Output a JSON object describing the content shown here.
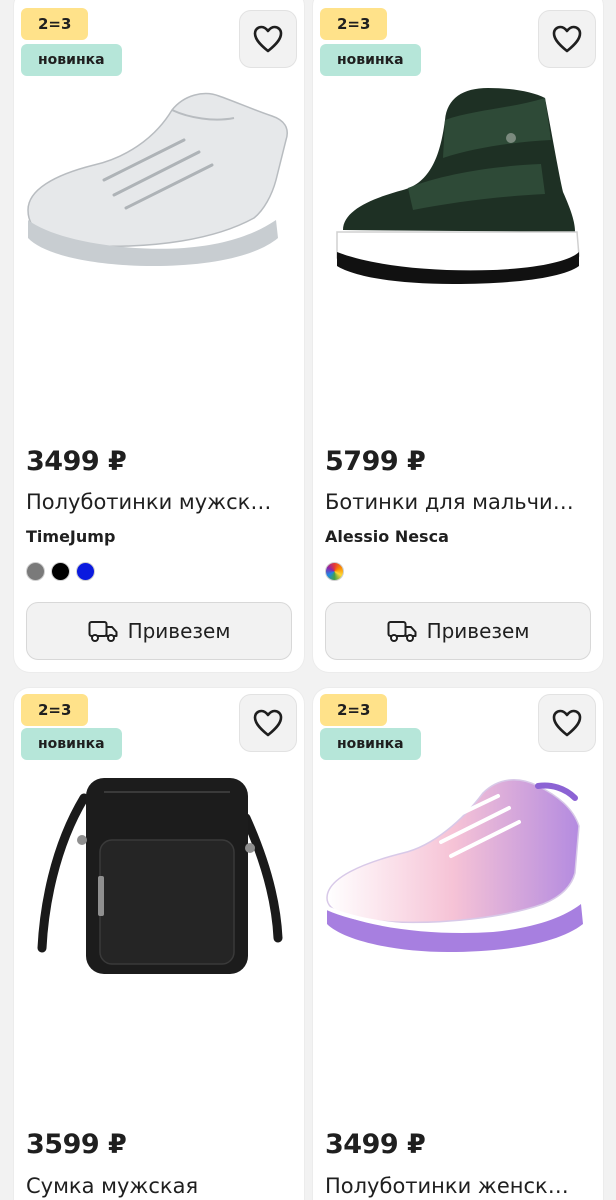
{
  "products": [
    {
      "promo": "2=3",
      "badge": "новинка",
      "price": "3499 ₽",
      "title": "Полуботинки мужск…",
      "brand": "TimeJump",
      "swatches": [
        "#7a7a7a",
        "#000000",
        "#0a1adf"
      ],
      "deliver_label": "Привезем",
      "image_icon": "sneaker-gray-icon"
    },
    {
      "promo": "2=3",
      "badge": "новинка",
      "price": "5799 ₽",
      "title": "Ботинки для мальчи…",
      "brand": "Alessio Nesca",
      "swatches": [
        "multicolor"
      ],
      "deliver_label": "Привезем",
      "image_icon": "boot-dark-green-icon"
    },
    {
      "promo": "2=3",
      "badge": "новинка",
      "price": "3599 ₽",
      "title": "Сумка мужская",
      "image_icon": "shoulder-bag-icon"
    },
    {
      "promo": "2=3",
      "badge": "новинка",
      "price": "3499 ₽",
      "title": "Полуботинки женск…",
      "image_icon": "sneaker-pink-icon"
    }
  ],
  "colors": {
    "promo_badge": "#ffe28a",
    "new_badge": "#b6e6d9",
    "card": "#ffffff",
    "background": "#f2f2f2"
  }
}
